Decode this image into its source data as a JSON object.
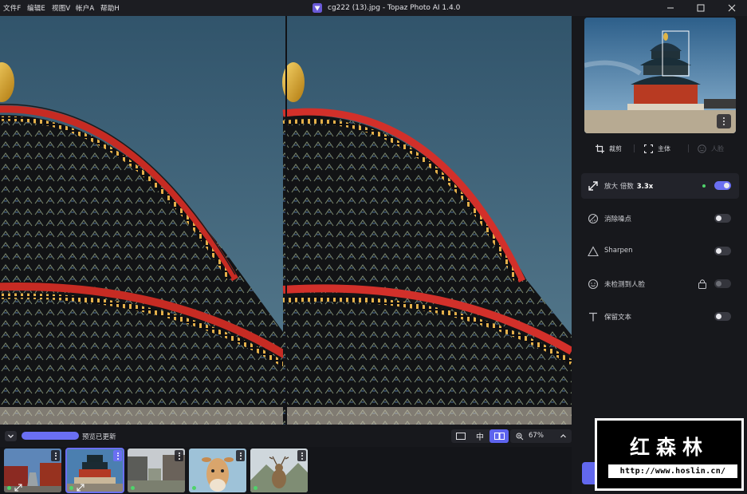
{
  "menu": {
    "file": "文件F",
    "edit": "编辑E",
    "view": "视图V",
    "account": "帐户A",
    "help": "帮助H"
  },
  "window": {
    "title": "cg222 (13).jpg - Topaz Photo AI 1.4.0",
    "app_icon": "topaz-logo-icon"
  },
  "status": {
    "progress_label": "预览已更新",
    "progress_percent": 100
  },
  "view_controls": {
    "single_icon": "single-view-icon",
    "side_label": "中",
    "split_icon": "split-view-icon",
    "zoom": "67%"
  },
  "filmstrip": {
    "thumbnails": [
      {
        "subject": "red-building",
        "selected": false
      },
      {
        "subject": "temple-of-heaven",
        "selected": true
      },
      {
        "subject": "courtyard",
        "selected": false
      },
      {
        "subject": "giraffe",
        "selected": false
      },
      {
        "subject": "deer",
        "selected": false
      }
    ]
  },
  "panel": {
    "tools": {
      "crop": "裁剪",
      "subject": "主体",
      "face": "人脸"
    },
    "features": {
      "upscale_label": "放大 倍数",
      "upscale_value": "3.3x",
      "denoise": "消除噪点",
      "sharpen": "Sharpen",
      "face_recovery": "未检测到人脸",
      "text_preserve": "保留文本"
    }
  },
  "watermark": {
    "name": "红森林",
    "url": "http://www.hoslin.cn/"
  },
  "colors": {
    "accent": "#6a6ff2",
    "status_green": "#4fd36b",
    "panel_bg": "#17181c",
    "sky": "#2b4a5e"
  }
}
